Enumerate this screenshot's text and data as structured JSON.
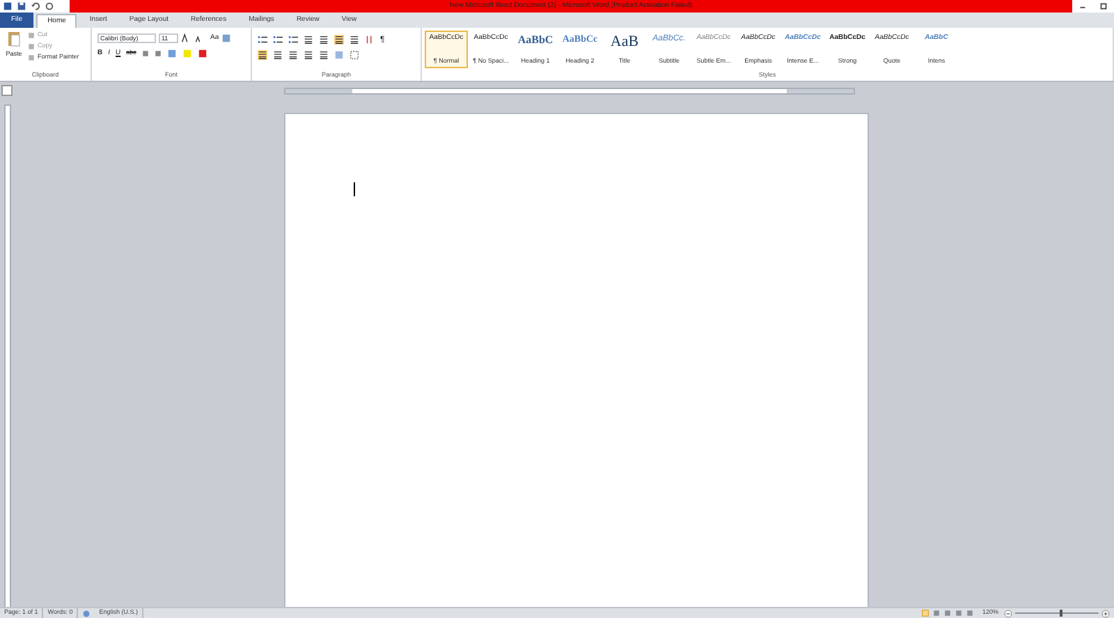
{
  "window": {
    "title": "New Microsoft Word Document (2) - Microsoft Word (Product Activation Failed)"
  },
  "tabs": [
    {
      "label": "File",
      "kind": "file"
    },
    {
      "label": "Home",
      "kind": "tab",
      "selected": true
    },
    {
      "label": "Insert",
      "kind": "tab",
      "selected": false
    },
    {
      "label": "Page Layout",
      "kind": "tab",
      "selected": false
    },
    {
      "label": "References",
      "kind": "tab",
      "selected": false
    },
    {
      "label": "Mailings",
      "kind": "tab",
      "selected": false
    },
    {
      "label": "Review",
      "kind": "tab",
      "selected": false
    },
    {
      "label": "View",
      "kind": "tab",
      "selected": false
    }
  ],
  "clipboard": {
    "paste": "Paste",
    "cut": "Cut",
    "copy": "Copy",
    "format_painter": "Format Painter",
    "label": "Clipboard"
  },
  "font": {
    "font_name": "Calibri (Body)",
    "font_size": "11",
    "change_case": "Aa",
    "bold": "B",
    "italic": "I",
    "underline": "U",
    "strikethrough": "abc",
    "label": "Font"
  },
  "paragraph": {
    "label": "Paragraph",
    "show_marks": "¶"
  },
  "styles": {
    "label": "Styles",
    "items": [
      {
        "preview": "AaBbCcDc",
        "name": "¶ Normal",
        "kind": "normal",
        "selected": true
      },
      {
        "preview": "AaBbCcDc",
        "name": "¶ No Spaci...",
        "kind": "normal",
        "selected": false
      },
      {
        "preview": "AaBbC",
        "name": "Heading 1",
        "kind": "heading1",
        "selected": false
      },
      {
        "preview": "AaBbCc",
        "name": "Heading 2",
        "kind": "heading2",
        "selected": false
      },
      {
        "preview": "AaB",
        "name": "Title",
        "kind": "title",
        "selected": false
      },
      {
        "preview": "AaBbCc.",
        "name": "Subtitle",
        "kind": "subtitle",
        "selected": false
      },
      {
        "preview": "AaBbCcDc",
        "name": "Subtle Em...",
        "kind": "subtle",
        "selected": false
      },
      {
        "preview": "AaBbCcDc",
        "name": "Emphasis",
        "kind": "emphasis",
        "selected": false
      },
      {
        "preview": "AaBbCcDc",
        "name": "Intense E...",
        "kind": "intense",
        "selected": false
      },
      {
        "preview": "AaBbCcDc",
        "name": "Strong",
        "kind": "strong",
        "selected": false
      },
      {
        "preview": "AaBbCcDc",
        "name": "Quote",
        "kind": "quote",
        "selected": false
      },
      {
        "preview": "AaBbC",
        "name": "Intens",
        "kind": "intense",
        "selected": false
      }
    ]
  },
  "status_bar": {
    "page": "Page: 1 of 1",
    "words": "Words: 0",
    "language": "English (U.S.)",
    "zoom": "120%",
    "zoom_slider": {
      "level": 0.55
    }
  }
}
